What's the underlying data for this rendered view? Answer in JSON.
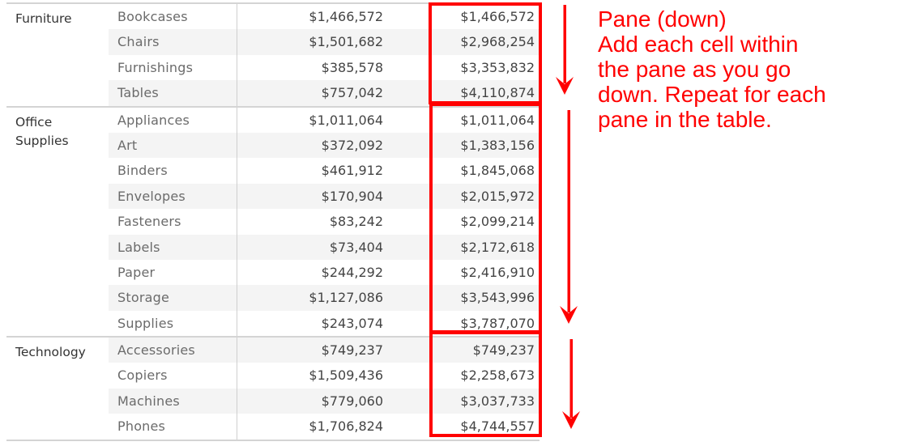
{
  "table": {
    "panes": [
      {
        "category": "Furniture",
        "rows": [
          {
            "sub_category": "Bookcases",
            "sales": "$1,466,572",
            "running_sum": "$1,466,572"
          },
          {
            "sub_category": "Chairs",
            "sales": "$1,501,682",
            "running_sum": "$2,968,254"
          },
          {
            "sub_category": "Furnishings",
            "sales": "$385,578",
            "running_sum": "$3,353,832"
          },
          {
            "sub_category": "Tables",
            "sales": "$757,042",
            "running_sum": "$4,110,874"
          }
        ]
      },
      {
        "category": "Office Supplies",
        "rows": [
          {
            "sub_category": "Appliances",
            "sales": "$1,011,064",
            "running_sum": "$1,011,064"
          },
          {
            "sub_category": "Art",
            "sales": "$372,092",
            "running_sum": "$1,383,156"
          },
          {
            "sub_category": "Binders",
            "sales": "$461,912",
            "running_sum": "$1,845,068"
          },
          {
            "sub_category": "Envelopes",
            "sales": "$170,904",
            "running_sum": "$2,015,972"
          },
          {
            "sub_category": "Fasteners",
            "sales": "$83,242",
            "running_sum": "$2,099,214"
          },
          {
            "sub_category": "Labels",
            "sales": "$73,404",
            "running_sum": "$2,172,618"
          },
          {
            "sub_category": "Paper",
            "sales": "$244,292",
            "running_sum": "$2,416,910"
          },
          {
            "sub_category": "Storage",
            "sales": "$1,127,086",
            "running_sum": "$3,543,996"
          },
          {
            "sub_category": "Supplies",
            "sales": "$243,074",
            "running_sum": "$3,787,070"
          }
        ]
      },
      {
        "category": "Technology",
        "rows": [
          {
            "sub_category": "Accessories",
            "sales": "$749,237",
            "running_sum": "$749,237"
          },
          {
            "sub_category": "Copiers",
            "sales": "$1,509,436",
            "running_sum": "$2,258,673"
          },
          {
            "sub_category": "Machines",
            "sales": "$779,060",
            "running_sum": "$3,037,733"
          },
          {
            "sub_category": "Phones",
            "sales": "$1,706,824",
            "running_sum": "$4,744,557"
          }
        ]
      }
    ]
  },
  "annotation": {
    "lines": [
      "Pane (down)",
      "Add each cell within",
      "the pane as you go",
      "down. Repeat for each",
      "pane in the table."
    ],
    "color": "#ff0000"
  },
  "colors": {
    "highlight": "#ff0000",
    "band": "#f4f4f4",
    "grid": "#d4d4d4"
  }
}
